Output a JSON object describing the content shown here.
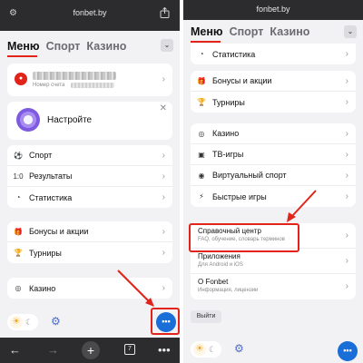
{
  "left": {
    "url": "fonbet.by",
    "tabs": [
      "Меню",
      "Спорт",
      "Казино"
    ],
    "account": {
      "sub_label": "Номер счета"
    },
    "setup_label": "Настройте",
    "menu_group1": [
      {
        "label": "Спорт",
        "icon": "⚽"
      },
      {
        "label": "Результаты",
        "icon": "1:0"
      },
      {
        "label": "Статистика",
        "icon": "◔"
      }
    ],
    "menu_group2": [
      {
        "label": "Бонусы и акции",
        "icon": "🎁"
      },
      {
        "label": "Турниры",
        "icon": "🏆"
      }
    ],
    "menu_group3": [
      {
        "label": "Казино",
        "icon": "◎"
      }
    ],
    "browser": {
      "tab_count": "7"
    }
  },
  "right": {
    "url": "fonbet.by",
    "tabs": [
      "Меню",
      "Спорт",
      "Казино"
    ],
    "group_a": [
      {
        "label": "Статистика",
        "icon": "◔"
      }
    ],
    "group_b": [
      {
        "label": "Бонусы и акции",
        "icon": "🎁"
      },
      {
        "label": "Турниры",
        "icon": "🏆"
      }
    ],
    "group_c": [
      {
        "label": "Казино",
        "icon": "◎"
      },
      {
        "label": "ТВ-игры",
        "icon": "▣"
      },
      {
        "label": "Виртуальный спорт",
        "icon": "◉"
      },
      {
        "label": "Быстрые игры",
        "icon": "⚡"
      }
    ],
    "help": {
      "title": "Справочный центр",
      "sub": "FAQ, обучение, словарь терминов"
    },
    "apps": {
      "title": "Приложения",
      "sub": "Для Android и iOS"
    },
    "about": {
      "title": "О Fonbet",
      "sub": "Информация, лицензии"
    },
    "logout": "Выйти"
  },
  "colors": {
    "brand_red": "#e2231a",
    "chat_blue": "#1a6ed8",
    "annotation_red": "#e2231a"
  }
}
